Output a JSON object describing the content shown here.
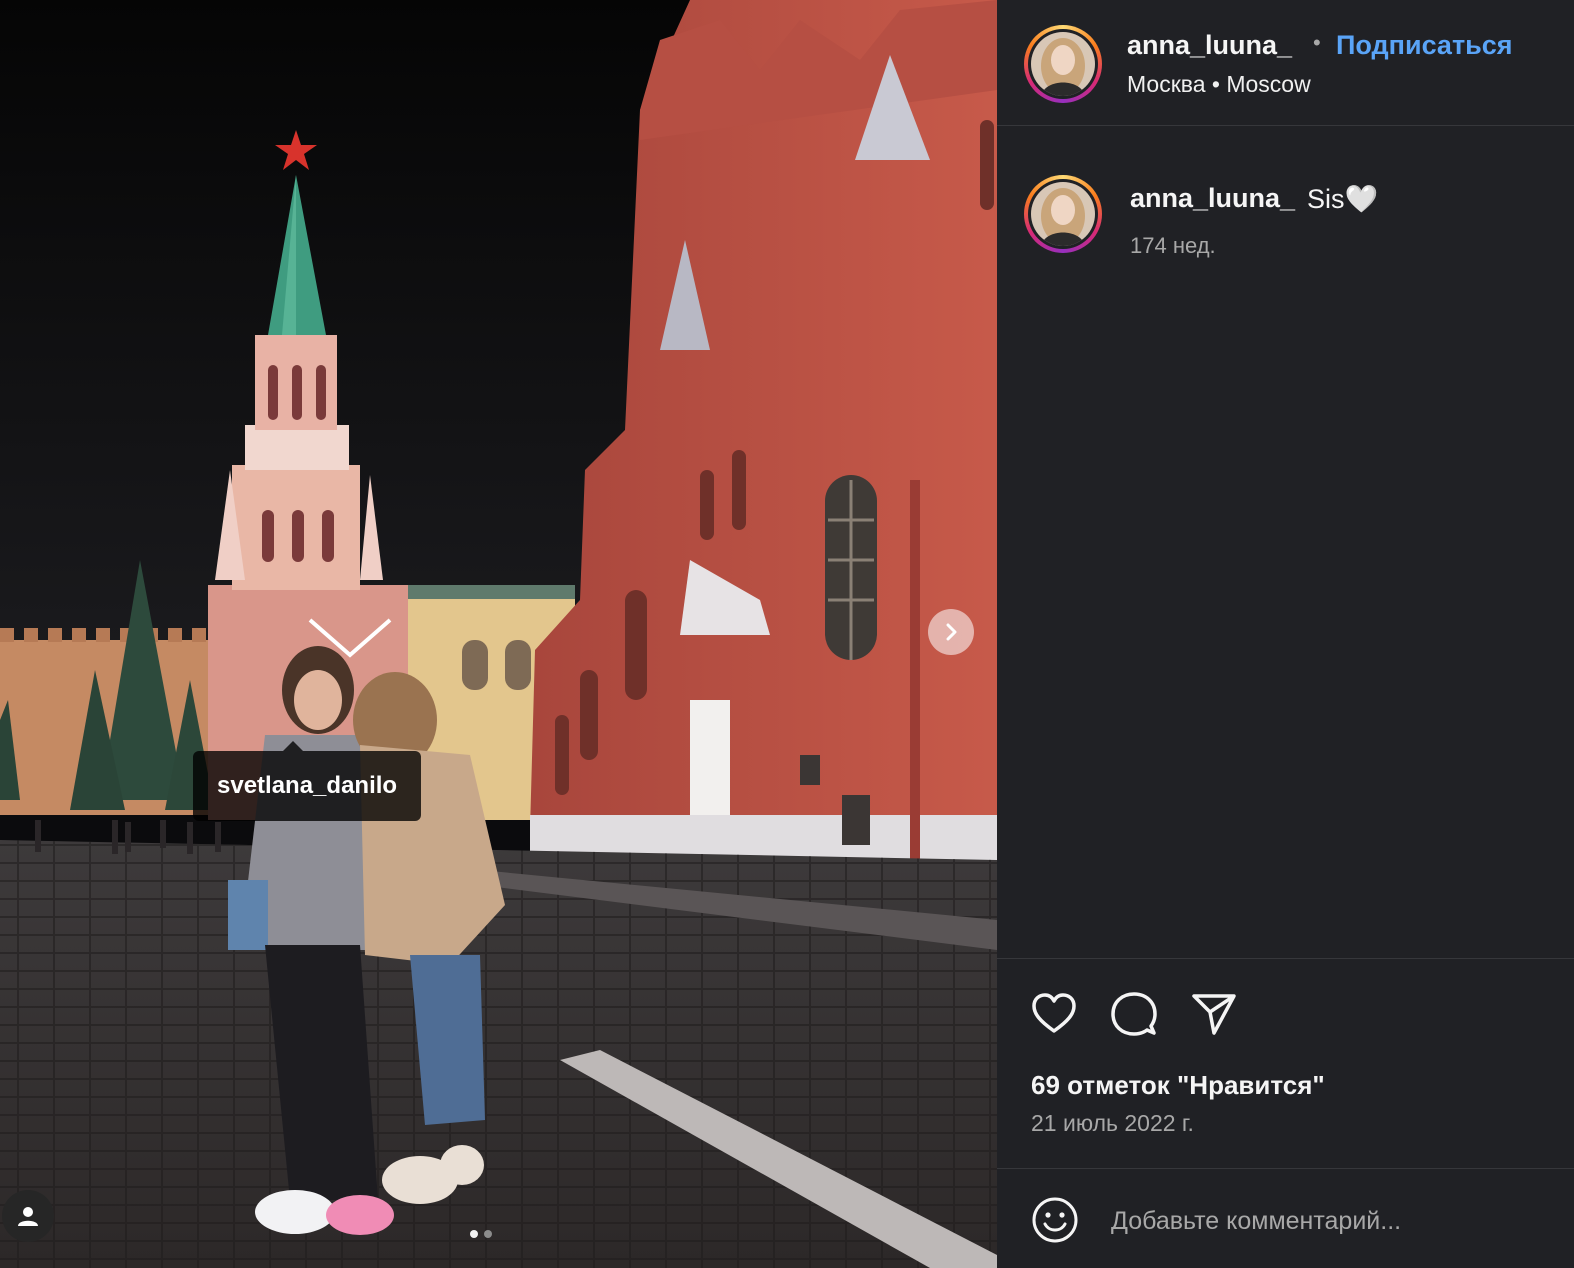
{
  "post": {
    "username": "anna_luuna_",
    "follow_label": "Подписаться",
    "separator": "•",
    "location": "Москва • Moscow",
    "tagged_user": "svetlana_danilo"
  },
  "caption": {
    "username": "anna_luuna_",
    "text": "Sis🤍",
    "age": "174 нед."
  },
  "actions": {
    "icons": [
      "heart-icon",
      "comment-icon",
      "share-icon"
    ],
    "likes": "69 отметок \"Нравится\"",
    "date": "21 июль 2022 г."
  },
  "comment_box": {
    "placeholder": "Добавьте комментарий..."
  },
  "carousel": {
    "current": 1,
    "total": 2
  },
  "colors": {
    "panel_bg": "#202125",
    "accent": "#5aa4f7",
    "muted_text": "#a8a8a8"
  }
}
